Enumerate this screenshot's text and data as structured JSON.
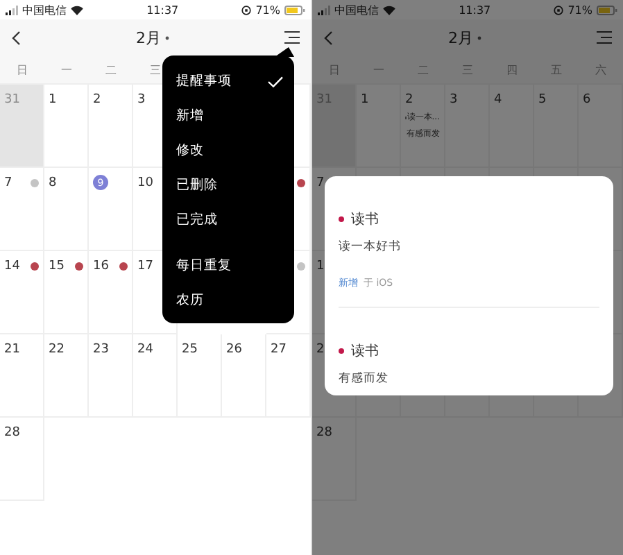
{
  "screens": [
    {
      "dimmed": false,
      "status_bar": {
        "carrier": "中国电信",
        "time": "11:37",
        "battery": "71%"
      },
      "nav": {
        "title": "2月"
      },
      "weekdays": [
        "日",
        "一",
        "二",
        "三"
      ],
      "weeks": [
        [
          {
            "label": "31",
            "outside": true,
            "today": false
          },
          {
            "label": "1",
            "outside": false,
            "today": false
          },
          {
            "label": "2",
            "outside": false,
            "today": false
          },
          {
            "label": "3",
            "outside": false,
            "today": false
          }
        ],
        [
          {
            "label": "7",
            "outside": false,
            "today": false,
            "color": "#c4c4c4"
          },
          {
            "label": "8",
            "outside": false,
            "today": false
          },
          {
            "label": "9",
            "outside": false,
            "today": true
          },
          {
            "label": "10",
            "outside": false,
            "today": false
          },
          {
            "color": "#b8454f"
          }
        ],
        [
          {
            "label": "14",
            "outside": false,
            "today": false,
            "color": "#b8454f"
          },
          {
            "label": "15",
            "outside": false,
            "today": false,
            "color": "#b8454f"
          },
          {
            "label": "16",
            "outside": false,
            "today": false,
            "color": "#b8454f"
          },
          {
            "label": "17",
            "outside": false,
            "today": false
          },
          {
            "color": "#c4c4c4"
          }
        ],
        [
          {
            "label": "21",
            "outside": false,
            "today": false
          },
          {
            "label": "22",
            "outside": false,
            "today": false
          },
          {
            "label": "23",
            "outside": false,
            "today": false
          },
          {
            "label": "24",
            "outside": false,
            "today": false
          },
          {
            "label": "25",
            "outside": false,
            "today": false
          },
          {
            "label": "26",
            "outside": false,
            "today": false
          },
          {
            "label": "27",
            "outside": false,
            "today": false
          }
        ],
        [
          {
            "label": "28",
            "outside": false,
            "today": false
          }
        ]
      ],
      "menu": {
        "groups": [
          [
            {
              "label": "提醒事项",
              "checked": true
            },
            {
              "label": "新增",
              "checked": false
            },
            {
              "label": "修改",
              "checked": false
            },
            {
              "label": "已删除",
              "checked": false
            },
            {
              "label": "已完成",
              "checked": false
            }
          ],
          [
            {
              "label": "每日重复",
              "checked": false
            },
            {
              "label": "农历",
              "checked": false
            }
          ]
        ]
      }
    },
    {
      "dimmed": true,
      "status_bar": {
        "carrier": "中国电信",
        "time": "11:37",
        "battery": "71%"
      },
      "nav": {
        "title": "2月"
      },
      "weekdays": [
        "日",
        "一",
        "二",
        "三",
        "四",
        "五",
        "六"
      ],
      "weeks": [
        [
          {
            "label": "31",
            "outside": true,
            "today": false
          },
          {
            "label": "1",
            "outside": false,
            "today": false
          },
          {
            "label": "2",
            "outside": false,
            "today": false,
            "events": [
              "读一本...",
              "有感而发"
            ]
          },
          {
            "label": "3",
            "outside": false,
            "today": false
          },
          {
            "label": "4",
            "outside": false,
            "today": false
          },
          {
            "label": "5",
            "outside": false,
            "today": false
          },
          {
            "label": "6",
            "outside": false,
            "today": false
          }
        ],
        [
          {
            "label": "7",
            "outside": false,
            "today": false
          }
        ],
        [
          {
            "label": "1",
            "outside": false,
            "today": false
          }
        ],
        [
          {
            "label": "2",
            "outside": false,
            "today": false
          }
        ],
        [
          {
            "label": "28",
            "outside": false,
            "today": false
          }
        ]
      ],
      "card": {
        "entries": [
          {
            "title": "读书",
            "color": "#c2184a",
            "body": "读一本好书",
            "source": {
              "action": "新增",
              "via": "于 iOS"
            }
          },
          {
            "title": "读书",
            "color": "#c2184a",
            "body": "有感而发"
          }
        ]
      }
    }
  ]
}
